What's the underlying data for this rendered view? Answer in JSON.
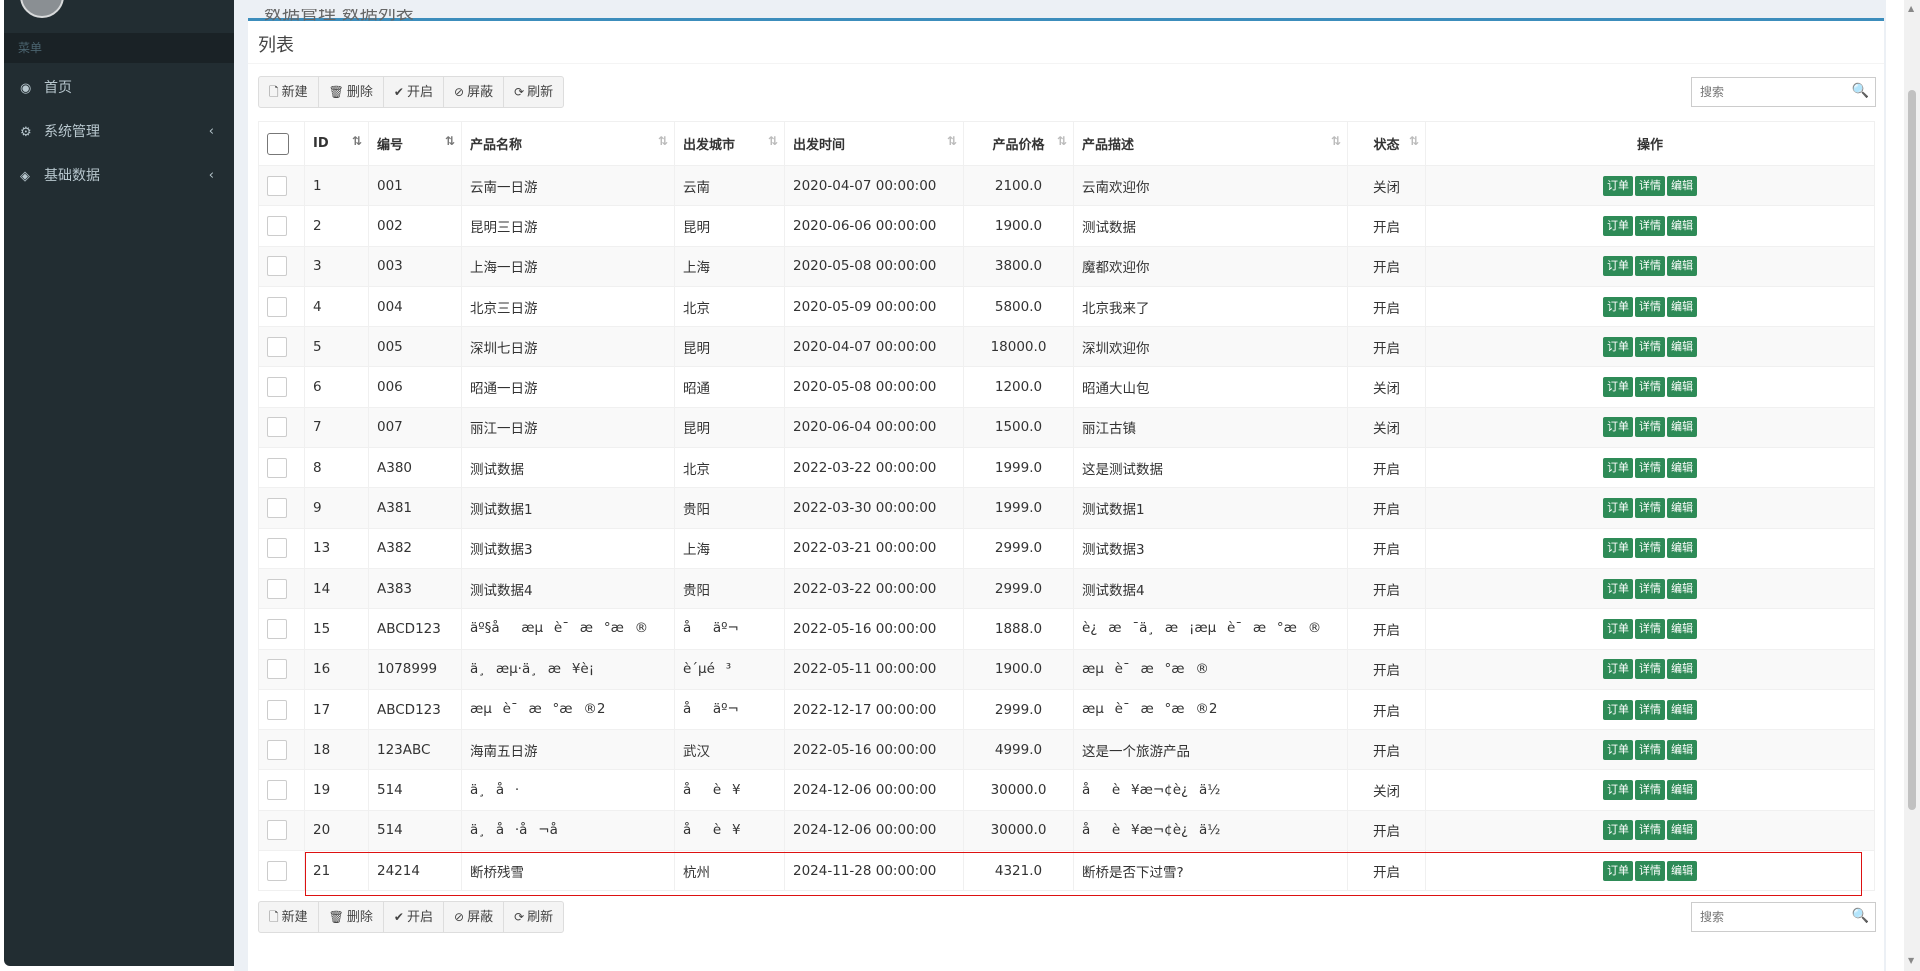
{
  "sidebar": {
    "menu_header": "菜单",
    "items": [
      {
        "icon": "dashboard-icon",
        "glyph": "◉",
        "label": "首页",
        "expandable": false
      },
      {
        "icon": "gears-icon",
        "glyph": "⚙",
        "label": "系统管理",
        "expandable": true
      },
      {
        "icon": "cube-icon",
        "glyph": "◈",
        "label": "基础数据",
        "expandable": true
      }
    ]
  },
  "page": {
    "partial_title": "数据管理 数据列表"
  },
  "box": {
    "title": "列表"
  },
  "toolbar": {
    "buttons": [
      {
        "icon": "file-icon",
        "glyph": "🗋",
        "label": "新建"
      },
      {
        "icon": "trash-icon",
        "glyph": "🗑",
        "label": "删除"
      },
      {
        "icon": "check-icon",
        "glyph": "✔",
        "label": "开启"
      },
      {
        "icon": "ban-icon",
        "glyph": "⊘",
        "label": "屏蔽"
      },
      {
        "icon": "refresh-icon",
        "glyph": "⟳",
        "label": "刷新"
      }
    ]
  },
  "search": {
    "placeholder": "搜索",
    "value": ""
  },
  "table": {
    "columns": [
      {
        "key": "id",
        "label": "ID",
        "sort": "active"
      },
      {
        "key": "code",
        "label": "编号",
        "sort": "active"
      },
      {
        "key": "name",
        "label": "产品名称",
        "sort": "idle"
      },
      {
        "key": "city",
        "label": "出发城市",
        "sort": "idle"
      },
      {
        "key": "time",
        "label": "出发时间",
        "sort": "idle"
      },
      {
        "key": "price",
        "label": "产品价格",
        "sort": "idle"
      },
      {
        "key": "desc",
        "label": "产品描述",
        "sort": "idle"
      },
      {
        "key": "status",
        "label": "状态",
        "sort": "idle"
      },
      {
        "key": "ops",
        "label": "操作",
        "sort": "none"
      }
    ],
    "action_labels": [
      "订单",
      "详情",
      "编辑"
    ],
    "rows": [
      {
        "id": "1",
        "code": "001",
        "name": "云南一日游",
        "city": "云南",
        "time": "2020-04-07 00:00:00",
        "price": "2100.0",
        "desc": "云南欢迎你",
        "status": "关闭"
      },
      {
        "id": "2",
        "code": "002",
        "name": "昆明三日游",
        "city": "昆明",
        "time": "2020-06-06 00:00:00",
        "price": "1900.0",
        "desc": "测试数据",
        "status": "开启"
      },
      {
        "id": "3",
        "code": "003",
        "name": "上海一日游",
        "city": "上海",
        "time": "2020-05-08 00:00:00",
        "price": "3800.0",
        "desc": "魔都欢迎你",
        "status": "开启"
      },
      {
        "id": "4",
        "code": "004",
        "name": "北京三日游",
        "city": "北京",
        "time": "2020-05-09 00:00:00",
        "price": "5800.0",
        "desc": "北京我来了",
        "status": "开启"
      },
      {
        "id": "5",
        "code": "005",
        "name": "深圳七日游",
        "city": "昆明",
        "time": "2020-04-07 00:00:00",
        "price": "18000.0",
        "desc": "深圳欢迎你",
        "status": "开启"
      },
      {
        "id": "6",
        "code": "006",
        "name": "昭通一日游",
        "city": "昭通",
        "time": "2020-05-08 00:00:00",
        "price": "1200.0",
        "desc": "昭通大山包",
        "status": "关闭"
      },
      {
        "id": "7",
        "code": "007",
        "name": "丽江一日游",
        "city": "昆明",
        "time": "2020-06-04 00:00:00",
        "price": "1500.0",
        "desc": "丽江古镇",
        "status": "关闭"
      },
      {
        "id": "8",
        "code": "A380",
        "name": "测试数据",
        "city": "北京",
        "time": "2022-03-22 00:00:00",
        "price": "1999.0",
        "desc": "这是测试数据",
        "status": "开启"
      },
      {
        "id": "9",
        "code": "A381",
        "name": "测试数据1",
        "city": "贵阳",
        "time": "2022-03-30 00:00:00",
        "price": "1999.0",
        "desc": "测试数据1",
        "status": "开启"
      },
      {
        "id": "13",
        "code": "A382",
        "name": "测试数据3",
        "city": "上海",
        "time": "2022-03-21 00:00:00",
        "price": "2999.0",
        "desc": "测试数据3",
        "status": "开启"
      },
      {
        "id": "14",
        "code": "A383",
        "name": "测试数据4",
        "city": "贵阳",
        "time": "2022-03-22 00:00:00",
        "price": "2999.0",
        "desc": "测试数据4",
        "status": "开启"
      },
      {
        "id": "15",
        "code": "ABCD123",
        "name": "äº§åæµè¯æ°æ®",
        "city": "åäº¬",
        "time": "2022-05-16 00:00:00",
        "price": "1888.0",
        "desc": "è¿æ¯ä¸æ¡æµè¯æ°æ®",
        "status": "开启"
      },
      {
        "id": "16",
        "code": "1078999",
        "name": "ä¸æµ·ä¸æ¥è¡",
        "city": "è´µé³",
        "time": "2022-05-11 00:00:00",
        "price": "1900.0",
        "desc": "æµè¯æ°æ®",
        "status": "开启"
      },
      {
        "id": "17",
        "code": "ABCD123",
        "name": "æµè¯æ°æ®2",
        "city": "åäº¬",
        "time": "2022-12-17 00:00:00",
        "price": "2999.0",
        "desc": "æµè¯æ°æ®2",
        "status": "开启"
      },
      {
        "id": "18",
        "code": "123ABC",
        "name": "海南五日游",
        "city": "武汉",
        "time": "2022-05-16 00:00:00",
        "price": "4999.0",
        "desc": "这是一个旅游产品",
        "status": "开启"
      },
      {
        "id": "19",
        "code": "514",
        "name": "ä¸å·",
        "city": "åè¥",
        "time": "2024-12-06 00:00:00",
        "price": "30000.0",
        "desc": "åè¥æ¬¢è¿ä½",
        "status": "关闭"
      },
      {
        "id": "20",
        "code": "514",
        "name": "ä¸å·å¬å",
        "city": "åè¥",
        "time": "2024-12-06 00:00:00",
        "price": "30000.0",
        "desc": "åè¥æ¬¢è¿ä½",
        "status": "开启"
      },
      {
        "id": "21",
        "code": "24214",
        "name": "断桥残雪",
        "city": "杭州",
        "time": "2024-11-28 00:00:00",
        "price": "4321.0",
        "desc": "断桥是否下过雪?",
        "status": "开启"
      }
    ]
  }
}
